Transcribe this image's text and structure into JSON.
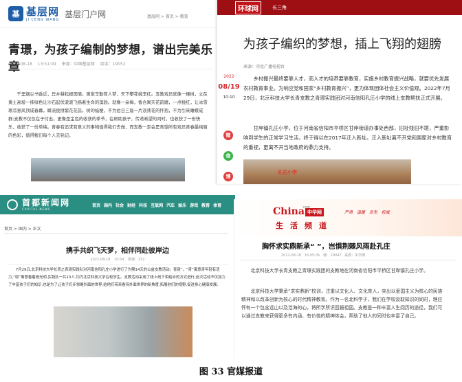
{
  "top_left": {
    "logo": {
      "cn": "基层网",
      "en": "JI CENG WANG"
    },
    "portal_label": "基层门户网",
    "breadcrumb": "基层网 > 首页 > 教育",
    "title": "青璟，为孩子编制的梦想，谱出完美乐章",
    "date": "2022-08-18 13:51:09",
    "source": "来源：中国基层网",
    "reads": "阅读：19052",
    "body": "千里烟尘书香近，异乡耕耘报国情。离家辛勤育人梦，天下攀花桃李红。支教戏员就像一棵树，立在黄土高坡一抹绿色让沙石起伏滚滚飞扬着生命的藻勃。就像一朵梅，香合寓天花韵磨，一点桃红，让冰雪寒凉意风顶成春幕，瞬流俊拼紫花花蕊。树的蛙梗，不为伯日三届一片浪荡花的怀抱，不为引来睡蝶成群;支教不仅仅在于付出，更像是金色的收获的季节，在帮助孩子，传递希望的同时，也收获了一份快乐，收获了一份单纯。青春有追求有意义的事物值得我们去做，而支教一定会是青璟所有戏员青春最绚丽的色彩，值得我们每个人去铭记。"
  },
  "top_right": {
    "logo": "环球网",
    "channel": "长三角",
    "title": "为孩子编织的梦想，插上飞翔的翅膀",
    "date": {
      "year": "·2022·",
      "day": "08/19",
      "time": "10:10"
    },
    "source": "来源：河北广播电视台",
    "share_icons": [
      "weibo-icon",
      "wechat-icon",
      "weibo-round-icon"
    ],
    "paragraphs": [
      "乡村振兴最终要靠人才，而人才的培养要靠教育，实施乡村教育振兴战略，就要优先发展农村教育事业。为响应党和国家“乡村教育振兴”，更为体现团体社会主义价值观。2022年7月29日，北京科技大学长青支教之青璟实践团对河南信阳孔庄小学的线上支教帮扶正式开展。",
      "甘岸镇孔庄小学，位于河南省信阳市平桥区甘岸街道办事处西部，旧址残旧不堪，严重影响到学生的正常学习生活，终于得以在2017年迁入新址。迁入新址离不开党和国家对乡村教育的重视，更离不开当地政府的鼎力支持。"
    ],
    "sign_text": "孔庄小学"
  },
  "bottom_left": {
    "logo": {
      "cn": "首都新闻网",
      "en": "CAPITAL NEWS"
    },
    "nav": [
      "首页",
      "国内",
      "社会",
      "财经",
      "科技",
      "互联网",
      "汽车",
      "娱乐",
      "游戏",
      "教育",
      "体育"
    ],
    "breadcrumb": "首页 > 国内 > 正文",
    "title": "携手共织飞天梦，相伴同赴彼岸边",
    "date": "2022-08-18 10:54",
    "reads": "阅读：252",
    "body": "7月29日,北京科技大学长青之青璟实践队对河南信阳孔庄小学进行了为期14天的公益支教活动。青璟”，“青”寓意青年轻有活力,“璟”寓意着着她光明,实践队一共13人,均为北京科技大学在校学生。支教活动采用了线上线下相结合的方式进行,此次活动不仅加力了丰富孩子们的知识,也是为了让孩子们步领略外面的世界,给他们带来看待外面世界的新角度,拓展他们的视野,促进身心健康发展。"
  },
  "bottom_right": {
    "logo": {
      "china": "China",
      "com": ".com",
      "box": "中华网"
    },
    "channel": "生活频道",
    "slogan": "严肃 温暖 京东 权威",
    "title": "胸怀求实鼎新承“  ”，岂惧荆棘风雨赴孔庄",
    "date": "2022-08-18 16:05:06",
    "reads": "29047",
    "source": "来源：中华网",
    "paragraphs": [
      "北京科技大学长青支教之青璟实践团的支教地在河南省信阳市平桥区甘岸镇孔庄小学。",
      "北京科技大学秉承“求实鼎新”校训，注重以文化人、文化育人，突出以爱国主义为核心的民族精神和以改革创新为核心的时代精神教育。作为一名北科学子，我们在学校汲取知识的同时，理应怀有一个包含远山以及沧海的心，将所学所识回报祖国。支教是一种丰富人生阅历的途径，我们可以通过支教来获得更多有内涵、有价值的精神体会，帮助了他人的同时也丰富了自己。"
    ]
  },
  "caption": "图 33 官媒报道"
}
